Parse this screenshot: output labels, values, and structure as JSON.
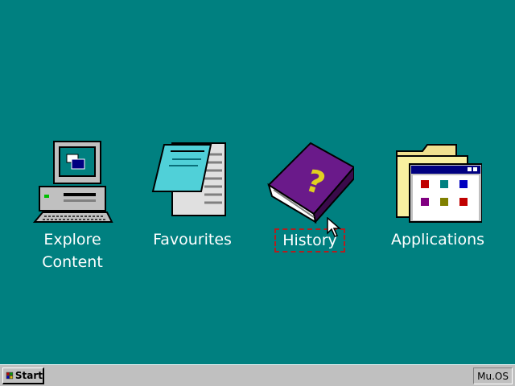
{
  "desktop": {
    "icons": [
      {
        "label": "Explore\nContent",
        "icon": "computer-icon"
      },
      {
        "label": "Favourites",
        "icon": "notepad-icon"
      },
      {
        "label": "History",
        "icon": "help-book-icon"
      },
      {
        "label": "Applications",
        "icon": "programs-folder-icon"
      }
    ],
    "selected_icon": "History",
    "background_color": "#008080"
  },
  "taskbar": {
    "start_label": "Start",
    "tray_label": "Mu.OS"
  }
}
